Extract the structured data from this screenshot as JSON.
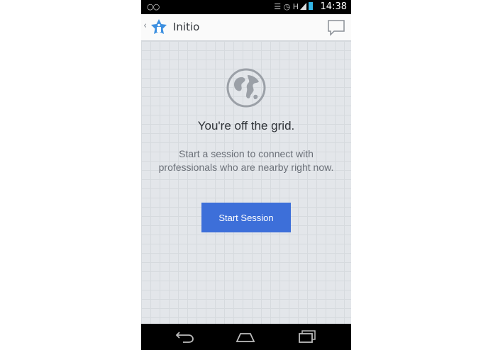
{
  "status_bar": {
    "time": "14:38",
    "network_label": "H",
    "icons": [
      "voicemail-icon",
      "vibrate-icon",
      "alarm-icon",
      "signal-icon",
      "battery-icon"
    ]
  },
  "action_bar": {
    "title": "Initio",
    "logo_color": "#3c8fe0"
  },
  "empty_state": {
    "icon": "globe-icon",
    "headline": "You're off the grid.",
    "message": "Start a session to connect with professionals who are nearby right now.",
    "button_label": "Start Session"
  },
  "colors": {
    "accent": "#3d6fd9",
    "background": "#e3e6ea"
  },
  "nav_bar": {
    "icons": [
      "back-icon",
      "home-icon",
      "recent-apps-icon"
    ]
  }
}
